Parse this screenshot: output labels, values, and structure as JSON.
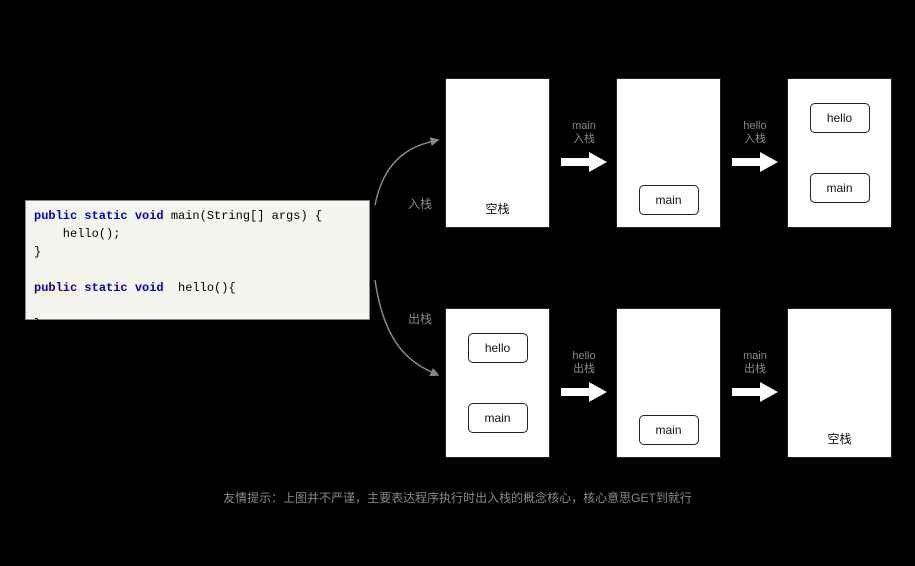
{
  "code": {
    "line1_pre": "public static void",
    "line1_post": " main(String[] args) {",
    "line2": "    hello();",
    "line3": "}",
    "line4_hl": "public",
    "line4_rest_kw": " static void",
    "line4_post": "  hello(){",
    "line5": "}"
  },
  "branches": {
    "push": "入栈",
    "pop": "出栈"
  },
  "push_row": {
    "box1_label": "空栈",
    "arrow1_caption": "main\n入栈",
    "box2_frame": "main",
    "arrow2_caption": "hello\n入栈",
    "box3_frame_top": "hello",
    "box3_frame_bot": "main"
  },
  "pop_row": {
    "box1_frame_top": "hello",
    "box1_frame_bot": "main",
    "arrow1_caption": "hello\n出栈",
    "box2_frame": "main",
    "arrow2_caption": "main\n出栈",
    "box3_label": "空栈"
  },
  "footer": "友情提示：上图并不严谨，主要表达程序执行时出入栈的概念核心，核心意思GET到就行"
}
